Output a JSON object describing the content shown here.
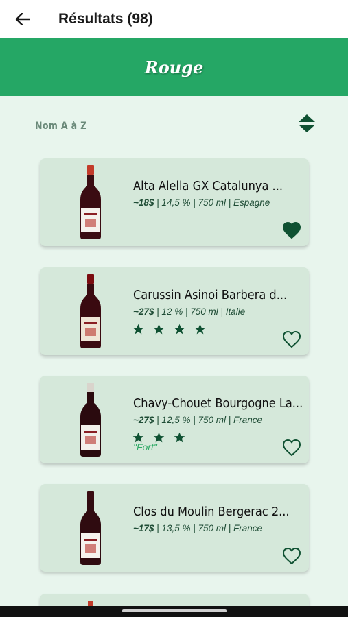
{
  "header": {
    "title": "Résultats (98)",
    "back_icon": "arrow-left-icon"
  },
  "banner": {
    "title": "Rouge",
    "background": "#25a765"
  },
  "sort": {
    "label": "Nom A à Z",
    "icon": "sort-toggle-icon"
  },
  "colors": {
    "accent": "#25a765",
    "dark_green": "#0f5132",
    "card_bg": "#d5e8da",
    "page_bg": "#e8f5ed"
  },
  "wines": [
    {
      "name": "Alta Alella GX Catalunya ...",
      "price": "~18$",
      "details": " | 14,5 % | 750 ml | Espagne",
      "stars": 0,
      "tag": "",
      "favorite": true
    },
    {
      "name": "Carussin Asinoi Barbera d...",
      "price": "~27$",
      "details": " | 12 % | 750 ml | Italie",
      "stars": 4,
      "tag": "",
      "favorite": false
    },
    {
      "name": "Chavy-Chouet Bourgogne La...",
      "price": "~27$",
      "details": " | 12,5 % | 750 ml | France",
      "stars": 3,
      "tag": "\"Fort\"",
      "favorite": false
    },
    {
      "name": "Clos du Moulin Bergerac 2...",
      "price": "~17$",
      "details": " | 13,5 % | 750 ml | France",
      "stars": 0,
      "tag": "",
      "favorite": false
    }
  ]
}
